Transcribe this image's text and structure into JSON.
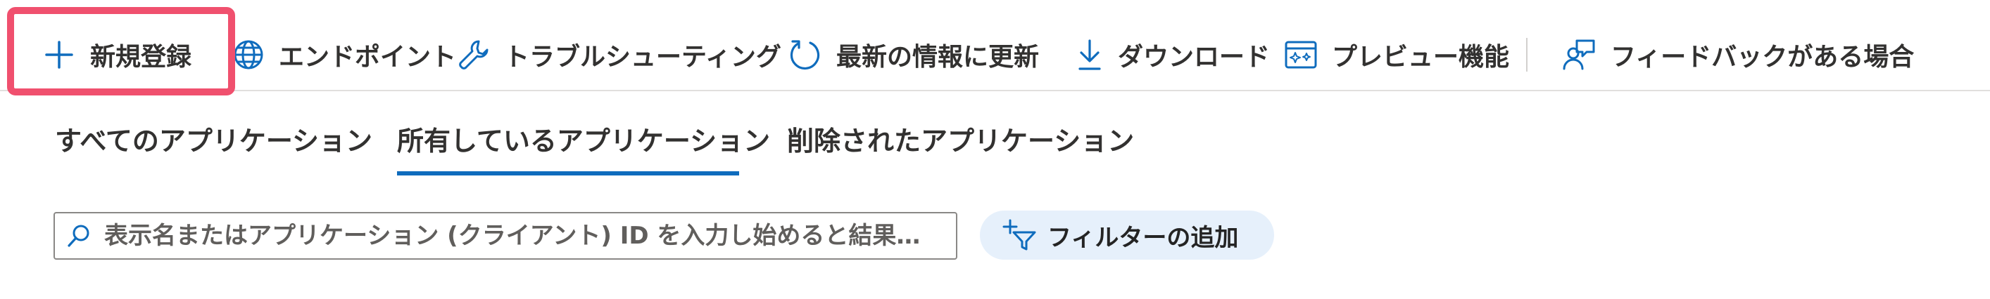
{
  "toolbar": {
    "new_registration": "新規登録",
    "endpoints": "エンドポイント",
    "troubleshooting": "トラブルシューティング",
    "refresh": "最新の情報に更新",
    "download": "ダウンロード",
    "preview_features": "プレビュー機能",
    "feedback": "フィードバックがある場合"
  },
  "tabs": [
    {
      "label": "すべてのアプリケーション",
      "selected": false
    },
    {
      "label": "所有しているアプリケーション",
      "selected": true
    },
    {
      "label": "削除されたアプリケーション",
      "selected": false
    }
  ],
  "search": {
    "placeholder": "表示名またはアプリケーション (クライアント) ID を入力し始めると結果…",
    "value": ""
  },
  "filter": {
    "label": "フィルターの追加"
  },
  "colors": {
    "accent": "#0f6cbd",
    "highlight": "#f0506e",
    "filter_bg": "#e6f0fb"
  },
  "icons": {
    "new_registration": "plus-icon",
    "endpoints": "globe-icon",
    "troubleshooting": "wrench-icon",
    "refresh": "refresh-icon",
    "download": "download-icon",
    "preview_features": "preview-icon",
    "feedback": "feedback-icon",
    "search": "search-icon",
    "filter": "add-filter-icon"
  }
}
